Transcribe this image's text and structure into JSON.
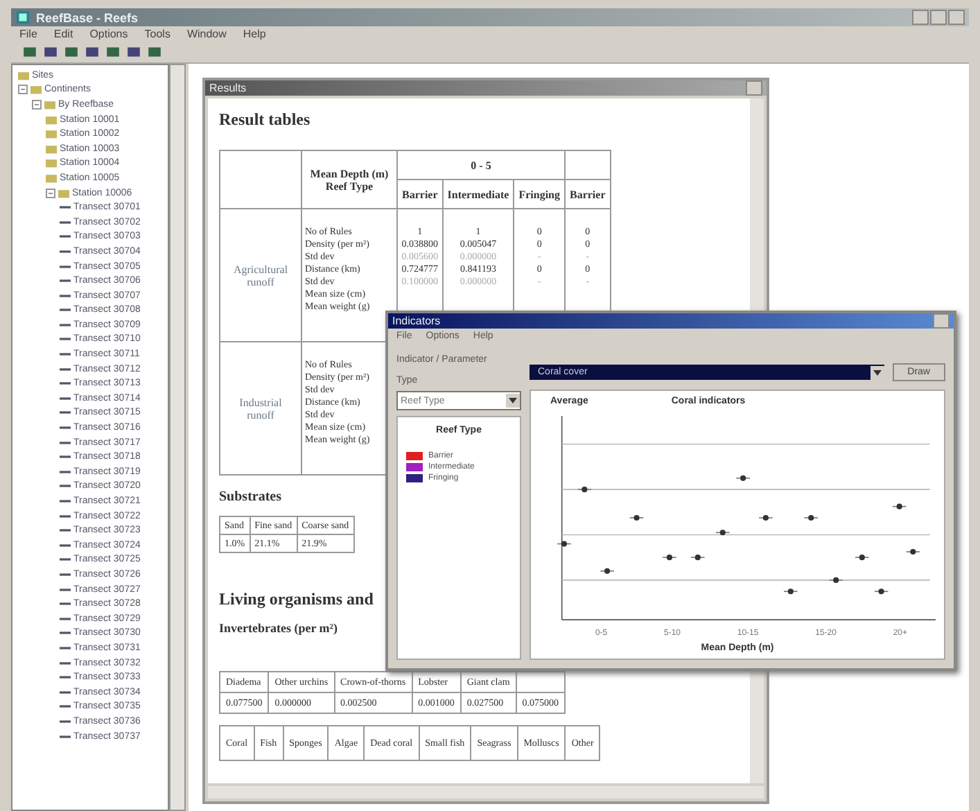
{
  "window": {
    "title": "ReefBase - Reefs"
  },
  "menu": [
    "File",
    "Edit",
    "Options",
    "Tools",
    "Window",
    "Help"
  ],
  "tree": [
    {
      "label": "Sites"
    },
    {
      "label": "Continents",
      "expanded": true,
      "children": [
        {
          "label": "By Reefbase",
          "expanded": true,
          "children": [
            {
              "label": "Station 10001"
            },
            {
              "label": "Station 10002"
            },
            {
              "label": "Station 10003"
            },
            {
              "label": "Station 10004"
            },
            {
              "label": "Station 10005"
            },
            {
              "label": "Station 10006",
              "expanded": true,
              "children": [
                {
                  "label": "Transect 30701"
                },
                {
                  "label": "Transect 30702"
                },
                {
                  "label": "Transect 30703"
                },
                {
                  "label": "Transect 30704"
                },
                {
                  "label": "Transect 30705"
                },
                {
                  "label": "Transect 30706"
                },
                {
                  "label": "Transect 30707"
                },
                {
                  "label": "Transect 30708"
                },
                {
                  "label": "Transect 30709"
                },
                {
                  "label": "Transect 30710"
                },
                {
                  "label": "Transect 30711"
                },
                {
                  "label": "Transect 30712"
                },
                {
                  "label": "Transect 30713"
                },
                {
                  "label": "Transect 30714"
                },
                {
                  "label": "Transect 30715"
                },
                {
                  "label": "Transect 30716"
                },
                {
                  "label": "Transect 30717"
                },
                {
                  "label": "Transect 30718"
                },
                {
                  "label": "Transect 30719"
                },
                {
                  "label": "Transect 30720"
                },
                {
                  "label": "Transect 30721"
                },
                {
                  "label": "Transect 30722"
                },
                {
                  "label": "Transect 30723"
                },
                {
                  "label": "Transect 30724"
                },
                {
                  "label": "Transect 30725"
                },
                {
                  "label": "Transect 30726"
                },
                {
                  "label": "Transect 30727"
                },
                {
                  "label": "Transect 30728"
                },
                {
                  "label": "Transect 30729"
                },
                {
                  "label": "Transect 30730"
                },
                {
                  "label": "Transect 30731"
                },
                {
                  "label": "Transect 30732"
                },
                {
                  "label": "Transect 30733"
                },
                {
                  "label": "Transect 30734"
                },
                {
                  "label": "Transect 30735"
                },
                {
                  "label": "Transect 30736"
                },
                {
                  "label": "Transect 30737"
                }
              ]
            }
          ]
        }
      ]
    }
  ],
  "results": {
    "title": "Results",
    "heading": "Result tables",
    "header": {
      "corner": "Mean Depth (m) Reef Type",
      "depth": "0 - 5",
      "types": [
        "Barrier",
        "Intermediate",
        "Fringing",
        "Barrier"
      ]
    },
    "groups": [
      {
        "label": "Agricultural runoff",
        "rows": [
          {
            "name": "No of Rules",
            "values": [
              "1",
              "1",
              "0",
              "0"
            ],
            "faint": false
          },
          {
            "name": "Density (per m²)",
            "values": [
              "0.038800",
              "0.005047",
              "0",
              "0"
            ],
            "faint": false
          },
          {
            "name": "Std dev",
            "values": [
              "0.005600",
              "0.000000",
              "-",
              "-"
            ],
            "faint": true
          },
          {
            "name": "Distance (km)",
            "values": [
              "0.724777",
              "0.841193",
              "0",
              "0"
            ],
            "faint": false
          },
          {
            "name": "Std dev",
            "values": [
              "0.100000",
              "0.000000",
              "-",
              "-"
            ],
            "faint": true
          },
          {
            "name": "Mean size (cm)"
          },
          {
            "name": "Mean weight (g)"
          }
        ]
      },
      {
        "label": "Industrial runoff",
        "rows": [
          {
            "name": "No of Rules"
          },
          {
            "name": "Density (per m²)"
          },
          {
            "name": "Std dev"
          },
          {
            "name": "Distance (km)"
          },
          {
            "name": "Std dev"
          },
          {
            "name": "Mean size (cm)"
          },
          {
            "name": "Mean weight (g)"
          }
        ]
      }
    ],
    "substrates": {
      "heading": "Substrates",
      "columns": [
        "Sand",
        "Fine sand",
        "Coarse sand"
      ],
      "values": [
        "1.0%",
        "21.1%",
        "21.9%"
      ]
    },
    "living_heading": "Living organisms and",
    "invertebrates": {
      "heading": "Invertebrates (per m²)",
      "columns": [
        "Diadema",
        "Other urchins",
        "Crown-of-thorns",
        "Lobster",
        "Giant clam"
      ],
      "values": [
        "0.077500",
        "0.000000",
        "0.002500",
        "0.001000",
        "0.027500",
        "0.075000"
      ]
    },
    "bottom_columns": [
      "Coral",
      "Fish",
      "Sponges",
      "Algae",
      "Dead coral",
      "Small fish",
      "Seagrass",
      "Molluscs",
      "Other"
    ]
  },
  "dialog": {
    "title": "Indicators",
    "menu": [
      "File",
      "Options",
      "Help"
    ],
    "indicator_label": "Indicator / Parameter",
    "indicator_value": "Coral cover",
    "button": "Draw",
    "type_label": "Type",
    "type_value": "Reef Type",
    "legend": {
      "title": "Reef Type",
      "items": [
        {
          "label": "Barrier",
          "color": "#e02020"
        },
        {
          "label": "Intermediate",
          "color": "#a020c0"
        },
        {
          "label": "Fringing",
          "color": "#302080"
        }
      ]
    },
    "chart": {
      "y_title": "Average",
      "title": "Coral indicators",
      "x_labels": [
        "0-5",
        "5-10",
        "10-15",
        "15-20",
        "20+"
      ],
      "xlabel": "Mean Depth (m)"
    }
  }
}
